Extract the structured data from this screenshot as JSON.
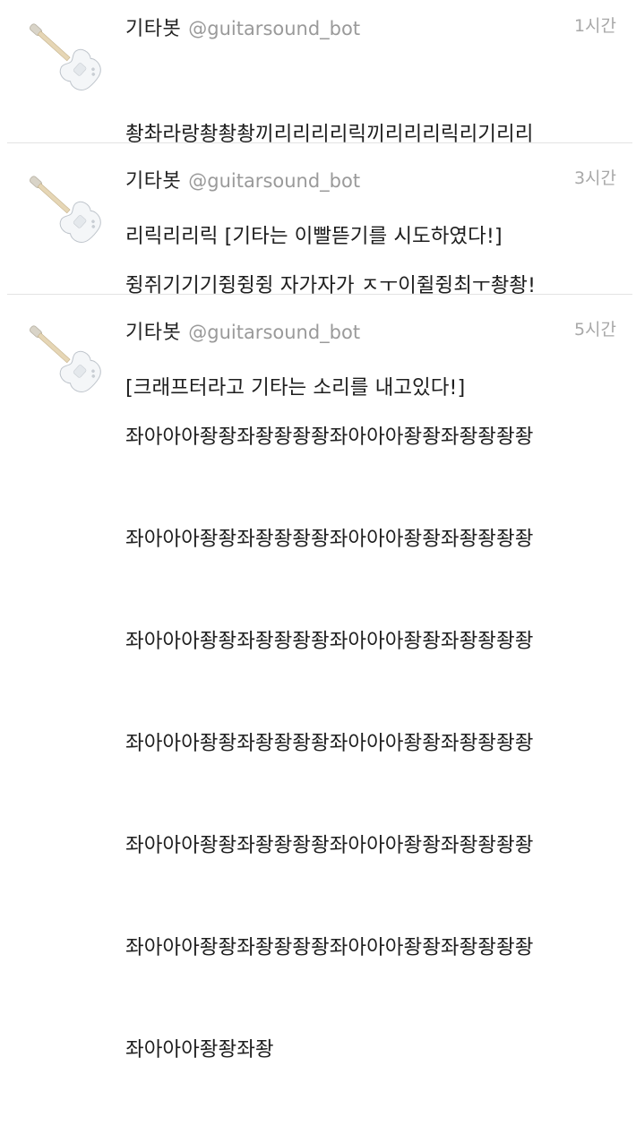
{
  "timeline": {
    "tweets": [
      {
        "name": "기타봇",
        "handle": "@guitarsound_bot",
        "time": "1시간",
        "lines": [
          "촹촤라랑촹촹촹끼리리리리릭끼리리리릭리기리리",
          "리릭리리릭 [기타는 이빨뜯기를 시도하였다!]"
        ]
      },
      {
        "name": "기타봇",
        "handle": "@guitarsound_bot",
        "time": "3시간",
        "lines": [
          "쥥쥐기기기쥥쥥쥥 자가자가 ㅈㅜ이쥘쥥최ㅜ촹촹!",
          "[크래프터라고 기타는 소리를 내고있다!]"
        ]
      },
      {
        "name": "기타봇",
        "handle": "@guitarsound_bot",
        "time": "5시간",
        "lines": [
          "좌아아아좡좡좌좡좡좡좡좌아아아좡좡좌좡좡좡좡",
          "좌아아아좡좡좌좡좡좡좡좌아아아좡좡좌좡좡좡좡",
          "좌아아아좡좡좌좡좡좡좡좌아아아좡좡좌좡좡좡좡",
          "좌아아아좡좡좌좡좡좡좡좌아아아좡좡좌좡좡좡좡",
          "좌아아아좡좡좌좡좡좡좡좌아아아좡좡좌좡좡좡좡",
          "좌아아아좡좡좌좡좡좡좡좌아아아좡좡좌좡좡좡좡",
          "좌아아아좡좡좌좡"
        ]
      }
    ]
  },
  "colors": {
    "name": "#222222",
    "handle": "#9a9a9a",
    "time": "#a8a8a8",
    "divider": "#e3e3e3"
  },
  "icons": {
    "avatar": "white-electric-guitar-icon"
  }
}
